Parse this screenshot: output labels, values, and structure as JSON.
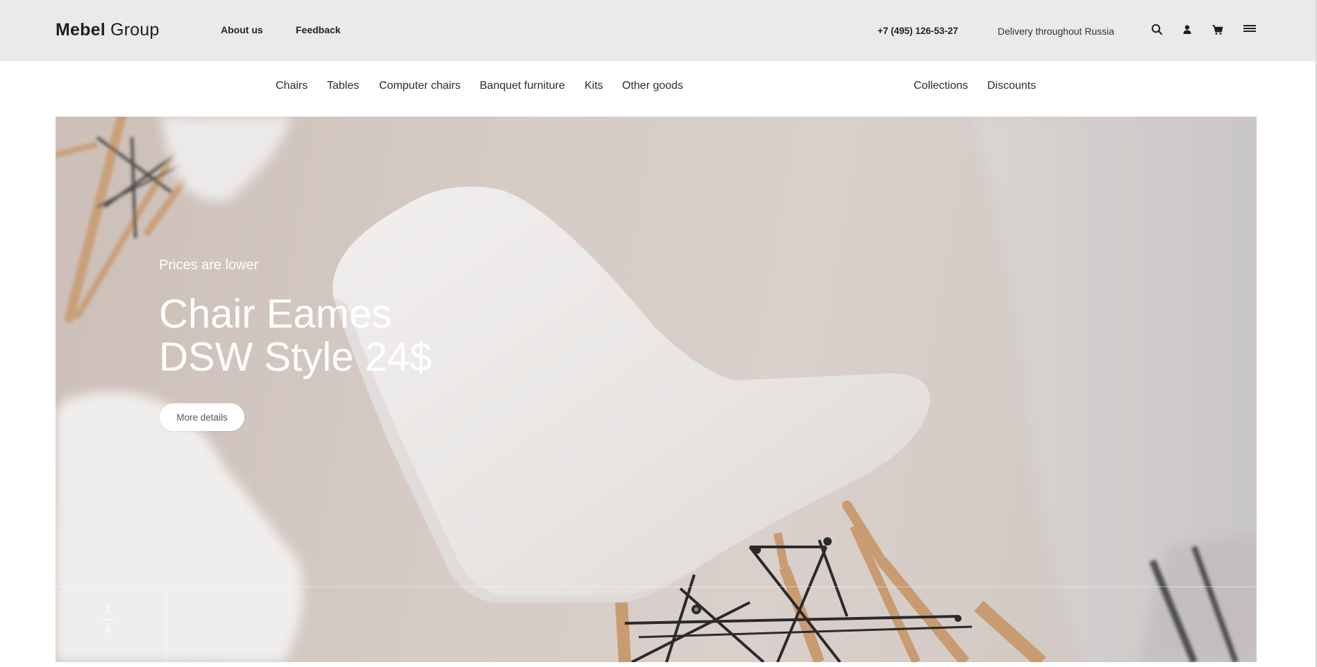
{
  "header": {
    "logo_bold": "Mebel",
    "logo_light": "Group",
    "links": [
      {
        "label": "About us"
      },
      {
        "label": "Feedback"
      }
    ],
    "phone": "+7 (495) 126-53-27",
    "delivery": "Delivery throughout Russia",
    "icons": [
      "search-icon",
      "user-icon",
      "cart-icon",
      "menu-icon"
    ]
  },
  "nav": {
    "categories": [
      {
        "label": "Chairs"
      },
      {
        "label": "Tables"
      },
      {
        "label": "Computer chairs"
      },
      {
        "label": "Banquet furniture"
      },
      {
        "label": "Kits"
      },
      {
        "label": "Other goods"
      }
    ],
    "secondary": [
      {
        "label": "Collections"
      },
      {
        "label": "Discounts"
      }
    ]
  },
  "hero": {
    "subtitle": "Prices are lower",
    "title_line1": "Chair Eames",
    "title_line2": "DSW Style 24$",
    "button": "More details",
    "pager": {
      "current": "1",
      "total": "4"
    }
  }
}
